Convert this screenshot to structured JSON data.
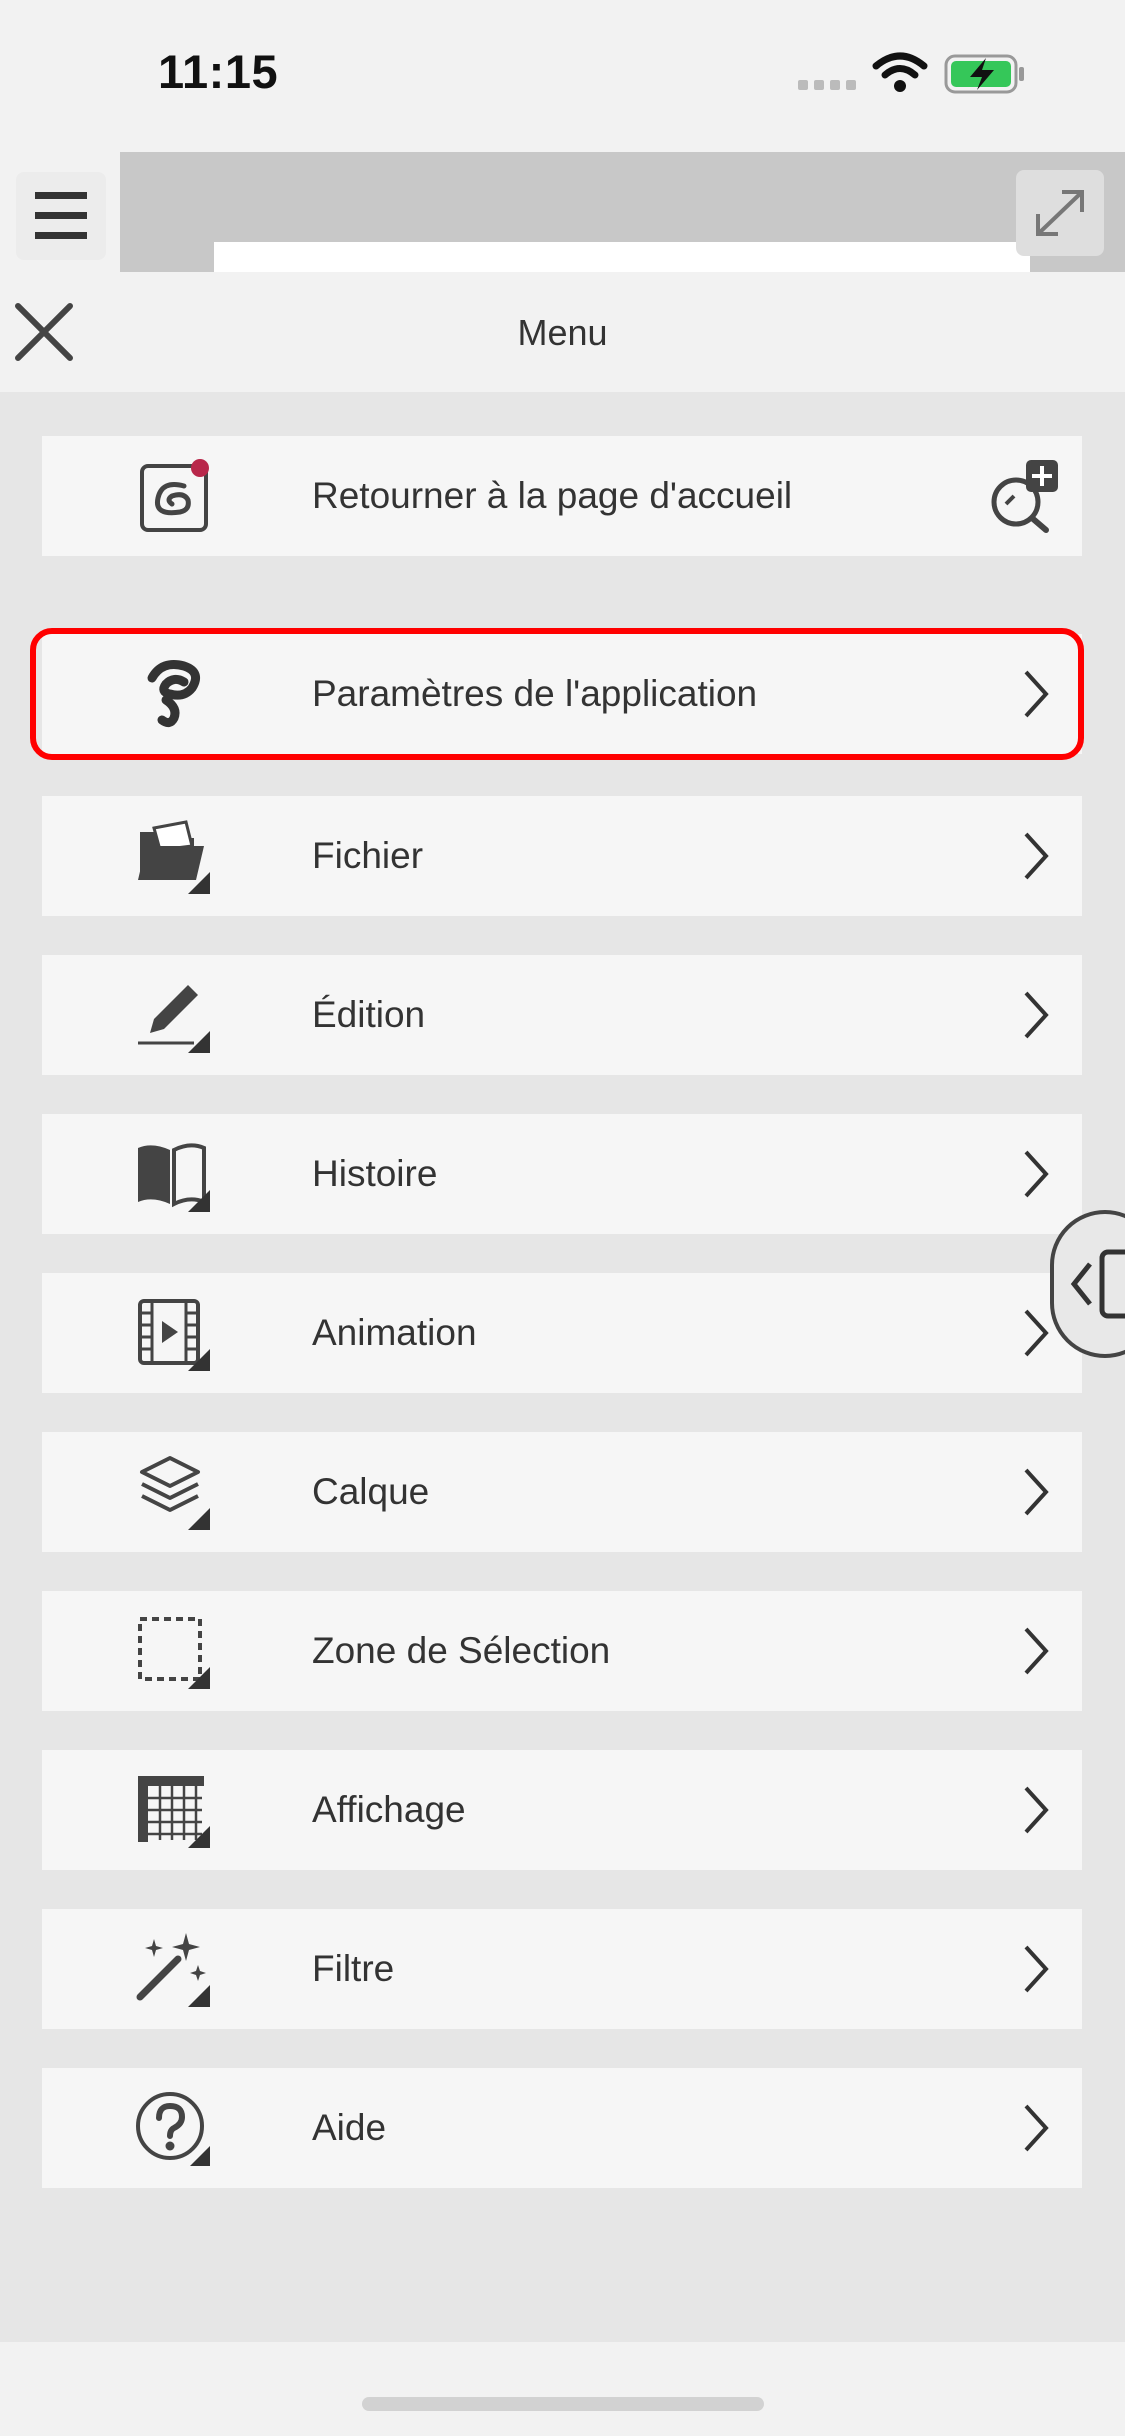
{
  "status_bar": {
    "time": "11:15",
    "icons": [
      "cellular-signal-icon",
      "wifi-icon",
      "battery-charging-icon"
    ],
    "battery_color": "#35c759"
  },
  "toolbar": {
    "icons": [
      "hamburger-icon",
      "expand-icon"
    ]
  },
  "menu": {
    "title": "Menu",
    "close_icon": "close-icon",
    "items": [
      {
        "label": "Retourner à la page d'accueil",
        "icon": "home-app-icon",
        "trailing_icon": "zoom-plus-icon",
        "notification_badge_color": "#b8274a"
      },
      {
        "label": "Paramètres de l'application",
        "icon": "app-settings-icon",
        "trailing_icon": "chevron-right-icon",
        "highlighted": true,
        "highlight_color": "#ff0000"
      },
      {
        "label": "Fichier",
        "icon": "folder-icon",
        "trailing_icon": "chevron-right-icon"
      },
      {
        "label": "Édition",
        "icon": "pencil-icon",
        "trailing_icon": "chevron-right-icon"
      },
      {
        "label": "Histoire",
        "icon": "book-icon",
        "trailing_icon": "chevron-right-icon"
      },
      {
        "label": "Animation",
        "icon": "film-icon",
        "trailing_icon": "chevron-right-icon"
      },
      {
        "label": "Calque",
        "icon": "layers-icon",
        "trailing_icon": "chevron-right-icon"
      },
      {
        "label": "Zone de Sélection",
        "icon": "selection-icon",
        "trailing_icon": "chevron-right-icon"
      },
      {
        "label": "Affichage",
        "icon": "grid-icon",
        "trailing_icon": "chevron-right-icon"
      },
      {
        "label": "Filtre",
        "icon": "magic-wand-icon",
        "trailing_icon": "chevron-right-icon"
      },
      {
        "label": "Aide",
        "icon": "help-icon",
        "trailing_icon": "chevron-right-icon"
      }
    ]
  },
  "side_tab": {
    "icon": "panel-toggle-icon"
  }
}
